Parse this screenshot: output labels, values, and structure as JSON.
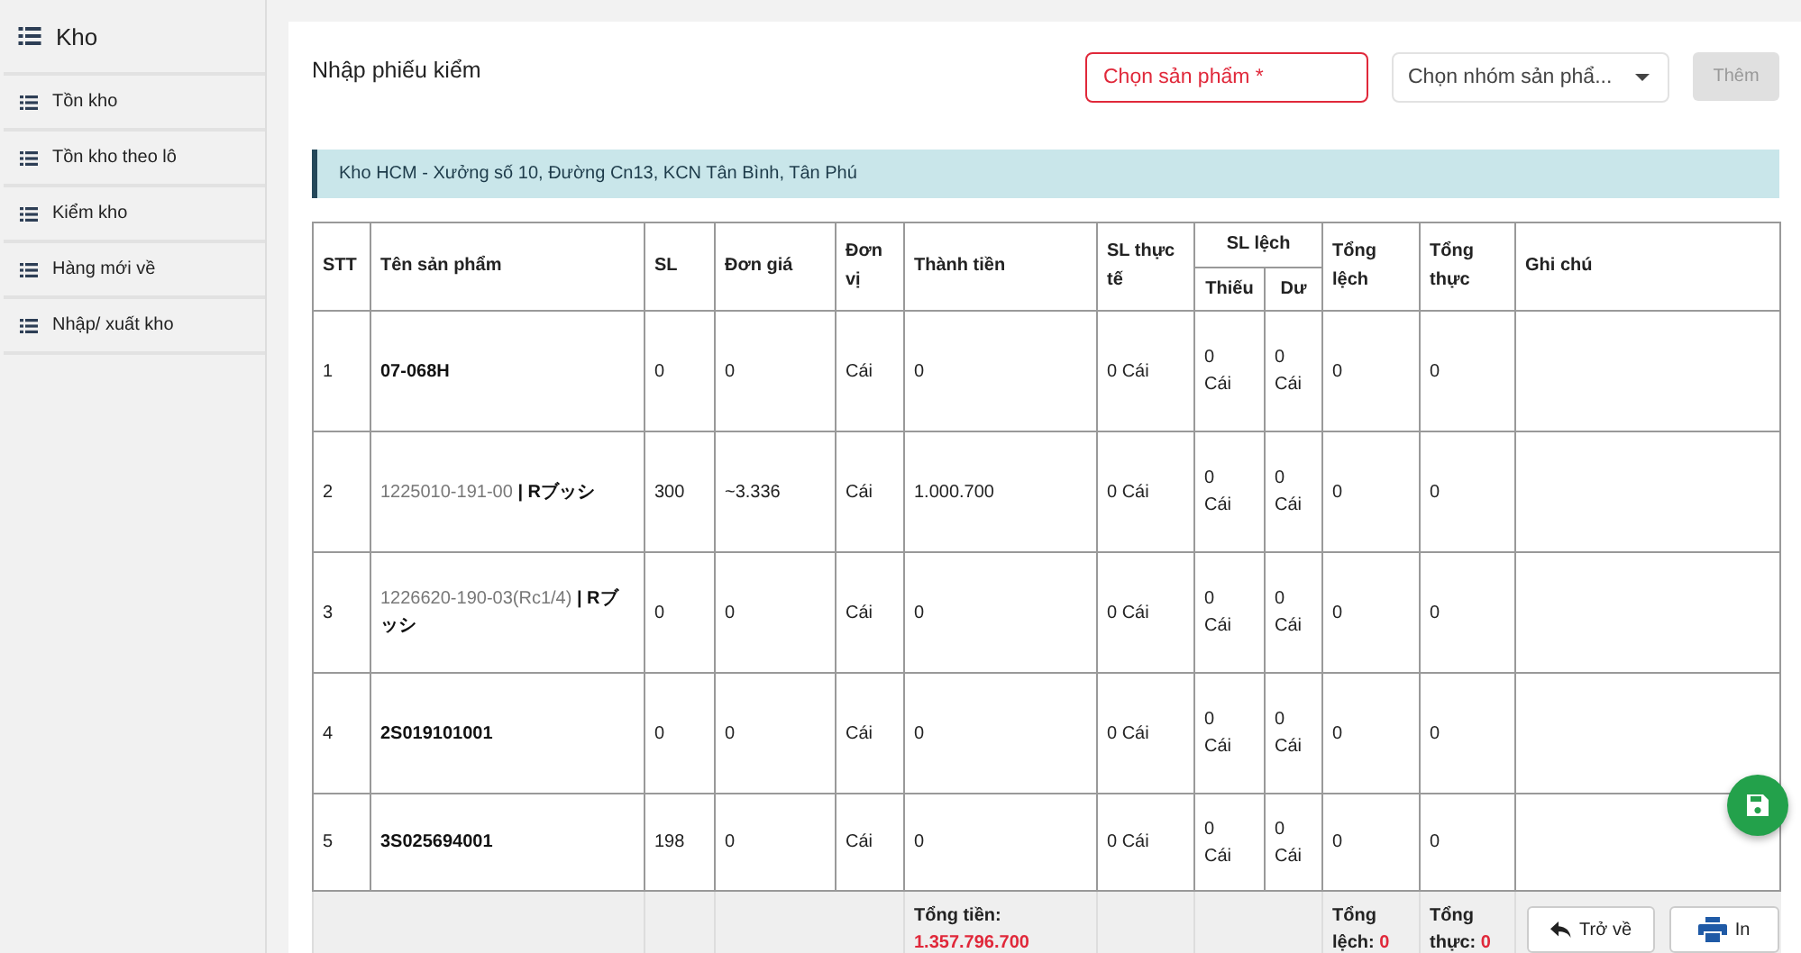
{
  "sidebar": {
    "title": "Kho",
    "items": [
      {
        "label": "Tồn kho"
      },
      {
        "label": "Tồn kho theo lô"
      },
      {
        "label": "Kiểm kho"
      },
      {
        "label": "Hàng mới về"
      },
      {
        "label": "Nhập/ xuất kho"
      }
    ]
  },
  "page_title": "Nhập phiếu kiểm",
  "product_field": {
    "placeholder": "Chọn sản phẩm *",
    "invalid": true
  },
  "group_select": {
    "placeholder": "Chọn nhóm sản phẩ..."
  },
  "add_button": {
    "label": "Thêm",
    "disabled": true
  },
  "warehouse": "Kho HCM - Xưởng số 10, Đường Cn13, KCN Tân Bình, Tân Phú",
  "table": {
    "columns": [
      {
        "label": "STT"
      },
      {
        "label": "Tên sản phẩm"
      },
      {
        "label": "SL"
      },
      {
        "label": "Đơn giá"
      },
      {
        "label": "Đơn vị"
      },
      {
        "label": "Thành tiền"
      },
      {
        "label": "SL thực tế"
      },
      {
        "label": "SL lệch",
        "children": [
          "Thiếu",
          "Dư"
        ]
      },
      {
        "label": "Tổng lệch"
      },
      {
        "label": "Tổng thực"
      },
      {
        "label": "Ghi chú"
      }
    ],
    "rows": [
      {
        "stt": "1",
        "product": "**07-068H**",
        "qty": "0",
        "unit_price": "0",
        "unit": "Cái",
        "amount": "0",
        "actual": "0  Cái",
        "short": "0 Cái",
        "excess": "0 Cái",
        "total_diff": "0",
        "total_actual": "0"
      },
      {
        "stt": "2",
        "product": "1225010-191-00 **| Rブッシ**",
        "qty": "300",
        "unit_price": "~3.336",
        "unit": "Cái",
        "amount": "1.000.700",
        "actual": "0  Cái",
        "short": "0 Cái",
        "excess": "0 Cái",
        "total_diff": "0",
        "total_actual": "0"
      },
      {
        "stt": "3",
        "product": "1226620-190-03(Rc1/4) **| Rブッシ**",
        "qty": "0",
        "unit_price": "0",
        "unit": "Cái",
        "amount": "0",
        "actual": "0  Cái",
        "short": "0 Cái",
        "excess": "0 Cái",
        "total_diff": "0",
        "total_actual": "0"
      },
      {
        "stt": "4",
        "product": "**2S019101001**",
        "qty": "0",
        "unit_price": "0",
        "unit": "Cái",
        "amount": "0",
        "actual": "0  Cái",
        "short": "0 Cái",
        "excess": "0 Cái",
        "total_diff": "0",
        "total_actual": "0"
      },
      {
        "stt": "5",
        "product": "**3S025694001**",
        "qty": "198",
        "unit_price": "0",
        "unit": "Cái",
        "amount": "0",
        "actual": "0  Cái",
        "short": "0 Cái",
        "excess": "0 Cái",
        "total_diff": "0",
        "total_actual": "0"
      }
    ],
    "footer": {
      "total_amount_label": "Tổng tiền:",
      "total_amount": "1.357.796.700",
      "total_diff_label": "Tổng lệch:",
      "total_diff": "0",
      "total_actual_label": "Tổng thực:",
      "total_actual": "0"
    }
  },
  "buttons": [
    {
      "kind": "back",
      "label": "Trở về"
    },
    {
      "kind": "print",
      "label": "In"
    }
  ]
}
